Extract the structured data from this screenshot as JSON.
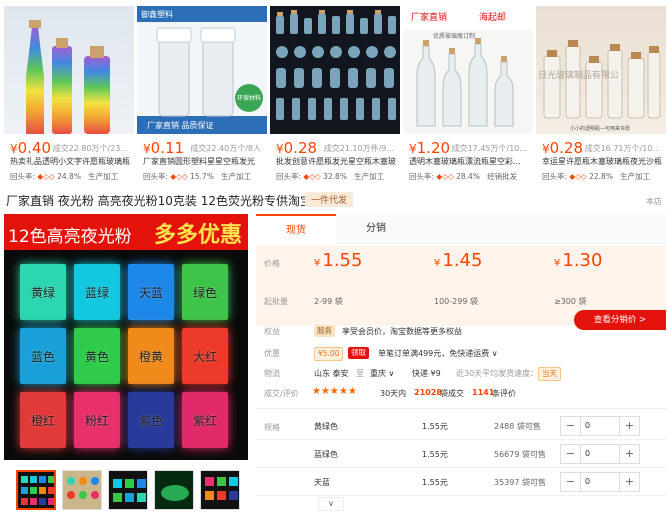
{
  "cards": [
    {
      "price": "0.40",
      "sold": "成交22.80万个/23...",
      "title": "热卖礼品透明小文字许愿瓶玻璃瓶",
      "meta_prefix": "回头率:",
      "meta_rate": "24.8%",
      "meta_suffix": "生产加工"
    },
    {
      "price": "0.11",
      "sold": "成交22.40万个/8人",
      "title": "厂家直销圆形塑料星星空瓶发光",
      "meta_prefix": "回头率:",
      "meta_rate": "15.7%",
      "meta_suffix": "生产加工"
    },
    {
      "price": "0.28",
      "sold": "成交21.10万件/9...",
      "title": "批发创意许愿瓶发光星空瓶木塞玻",
      "meta_prefix": "回头率:",
      "meta_rate": "32.8%",
      "meta_suffix": "生产加工"
    },
    {
      "price": "1.20",
      "sold": "成交17.45万个/10...",
      "title": "透明木塞玻璃瓶漂流瓶星空彩...",
      "meta_prefix": "回头率:",
      "meta_rate": "28.4%",
      "meta_suffix": "经销批发"
    },
    {
      "price": "0.28",
      "sold": "成交16.71万个/10...",
      "title": "幸运星许愿瓶木塞玻璃瓶夜光沙瓶",
      "meta_prefix": "回头率:",
      "meta_rate": "22.8%",
      "meta_suffix": "生产加工"
    }
  ],
  "card2_overlay": {
    "top": "御鑫塑料",
    "bottom": "厂家直销 品质保证",
    "badge": "环保材料"
  },
  "card4_overlay": {
    "left": "厂家直销",
    "right": "海起邮",
    "sub": "优质玻璃瓶订制"
  },
  "card5_overlay": {
    "wm": "日光玻璃制品有限公",
    "sub": "小小的透明瓶—可用来许愿"
  },
  "headline": "厂家直销 夜光粉 高亮夜光粉10克装 12色荧光粉专供淘宝",
  "headline_tag": "一件代发",
  "shop_note": "本店",
  "banner": {
    "left": "12色高亮夜光粉",
    "right": "多多优惠"
  },
  "swatches": [
    {
      "label": "黄绿",
      "color": "#2bd6b0"
    },
    {
      "label": "蓝绿",
      "color": "#12c8e0"
    },
    {
      "label": "天蓝",
      "color": "#1e88e8"
    },
    {
      "label": "绿色",
      "color": "#3fc44a"
    },
    {
      "label": "蓝色",
      "color": "#1aa0d8"
    },
    {
      "label": "黄色",
      "color": "#2ecc4a"
    },
    {
      "label": "橙黄",
      "color": "#f08a1a"
    },
    {
      "label": "大红",
      "color": "#ee3a2a"
    },
    {
      "label": "橙红",
      "color": "#e23a3a"
    },
    {
      "label": "粉红",
      "color": "#e8306a"
    },
    {
      "label": "紫色",
      "color": "#283a9a"
    },
    {
      "label": "紫红",
      "color": "#e02a6a"
    }
  ],
  "tabs": [
    "现货",
    "分销"
  ],
  "price_label": "价格",
  "moq_label": "起批量",
  "tiers": [
    {
      "price": "1.55",
      "range": "2-99 袋"
    },
    {
      "price": "1.45",
      "range": "100-299 袋"
    },
    {
      "price": "1.30",
      "range": "≥300 袋"
    }
  ],
  "currency": "¥",
  "dist_button": "查看分销价  >",
  "rights": {
    "label": "权益",
    "badge": "服务",
    "text": "享受会员价，淘宝数据等更多权益"
  },
  "promo": {
    "label": "优惠",
    "coupon_amount": "¥5.00",
    "coupon_action": "领取",
    "text": "单笔订单满499元，免快递运费 ∨"
  },
  "logistics": {
    "label": "物流",
    "from": "山东 泰安",
    "to_word": "至",
    "to": "重庆 ∨",
    "fee": "快递 ¥9",
    "speed": "近30天平均发货速度：",
    "speed_badge": "当天"
  },
  "review": {
    "label": "成交/评价",
    "stars": "★★★★★",
    "deal_prefix": "30天内",
    "deal_count": "21028",
    "deal_suffix": "袋成交",
    "review_count": "1141",
    "review_suffix": "条评价"
  },
  "spec_label": "规格",
  "specs": [
    {
      "name": "黄绿色",
      "price": "1.55元",
      "stock": "2488 袋可售",
      "qty": "0"
    },
    {
      "name": "蓝绿色",
      "price": "1.55元",
      "stock": "56679 袋可售",
      "qty": "0"
    },
    {
      "name": "天蓝",
      "price": "1.55元",
      "stock": "35397 袋可售",
      "qty": "0"
    }
  ],
  "qty_minus": "−",
  "qty_plus": "+",
  "more": "∨"
}
